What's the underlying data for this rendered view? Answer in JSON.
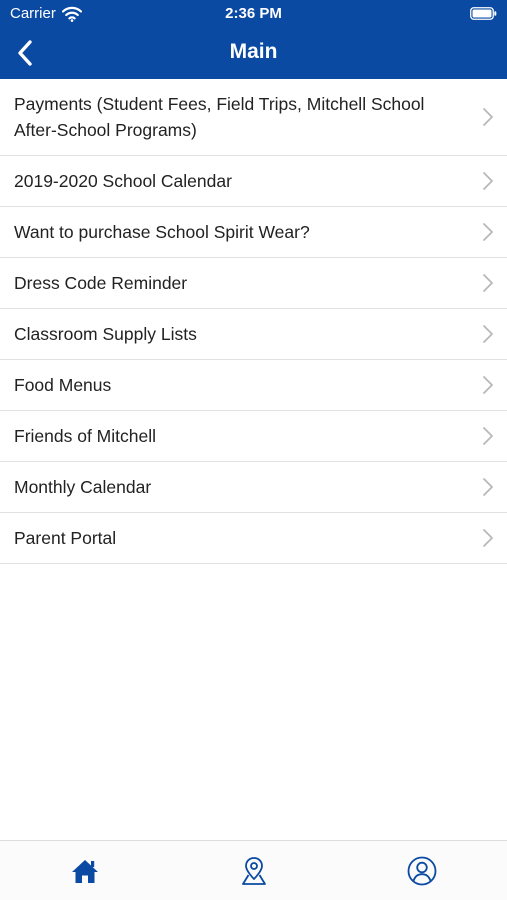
{
  "status_bar": {
    "carrier": "Carrier",
    "time": "2:36 PM"
  },
  "nav": {
    "title": "Main",
    "back_icon": "chevron-left-icon"
  },
  "menu": {
    "items": [
      {
        "label": "Payments (Student Fees, Field Trips, Mitchell School After-School Programs)"
      },
      {
        "label": "2019-2020 School Calendar"
      },
      {
        "label": "Want to purchase School Spirit Wear?"
      },
      {
        "label": "Dress Code Reminder"
      },
      {
        "label": "Classroom Supply Lists"
      },
      {
        "label": "Food Menus"
      },
      {
        "label": "Friends of Mitchell"
      },
      {
        "label": "Monthly Calendar"
      },
      {
        "label": "Parent Portal"
      }
    ]
  },
  "tab_bar": {
    "tabs": [
      {
        "icon": "home-icon",
        "active": true
      },
      {
        "icon": "map-pin-icon",
        "active": false
      },
      {
        "icon": "profile-icon",
        "active": false
      }
    ]
  },
  "colors": {
    "header_bg": "#0a4aa3",
    "accent": "#0a4aa3",
    "chevron": "#b8b8b8",
    "divider": "#e1e1e1"
  }
}
